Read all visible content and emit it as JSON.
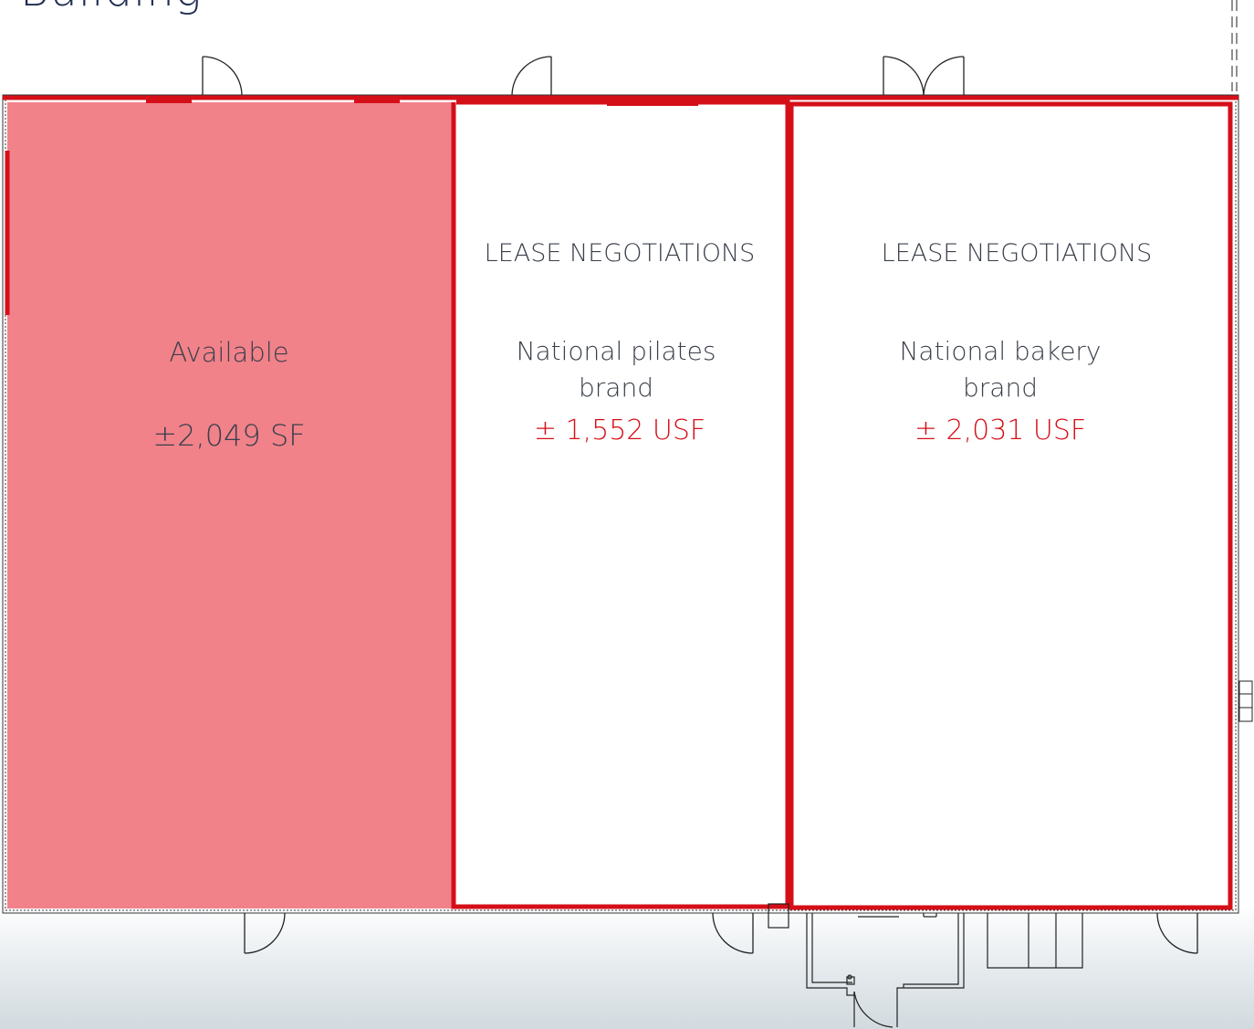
{
  "page": {
    "heading": "Building"
  },
  "colors": {
    "wall_red": "#d50f18",
    "available_fill": "#f1828a",
    "heading_navy": "#1f2b52",
    "label_gray": "#3a3f4a",
    "linework": "#222222"
  },
  "suites": [
    {
      "status": "",
      "tenant": "Available",
      "area": "±2,049 SF",
      "state": "available"
    },
    {
      "status": "LEASE NEGOTIATIONS",
      "tenant": "National pilates brand",
      "area": "± 1,552 USF",
      "state": "negotiating"
    },
    {
      "status": "LEASE NEGOTIATIONS",
      "tenant": "National bakery brand",
      "area": "± 2,031 USF",
      "state": "negotiating"
    }
  ]
}
